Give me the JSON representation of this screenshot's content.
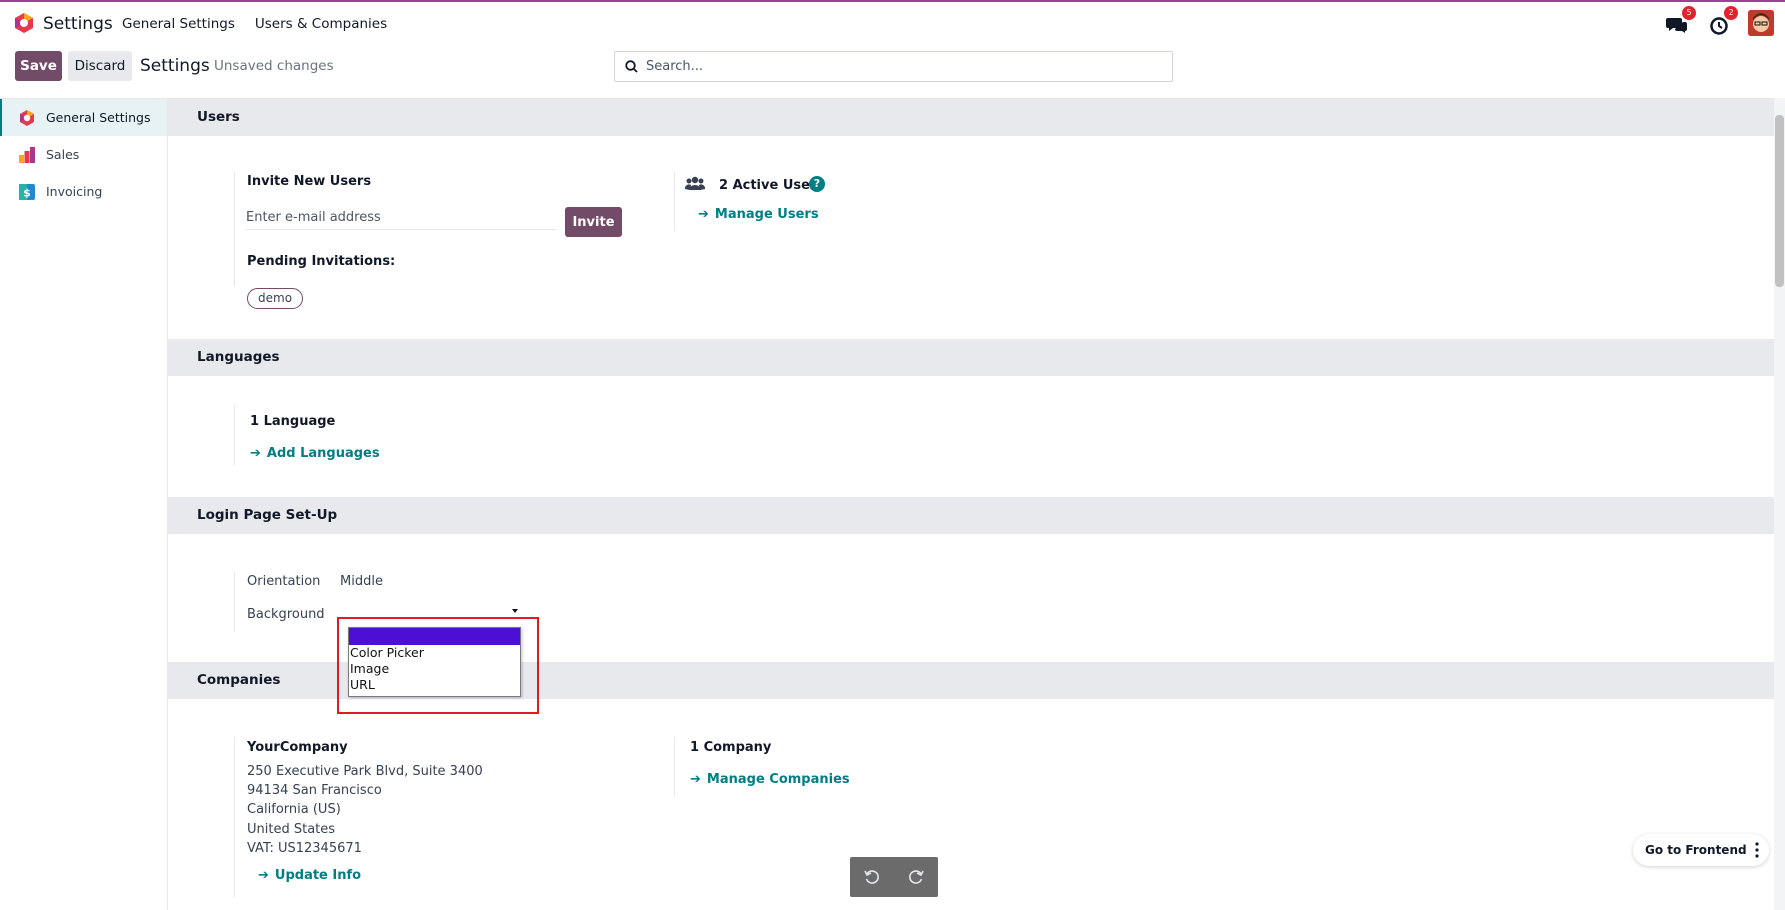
{
  "navbar": {
    "app_title": "Settings",
    "menu": [
      "General Settings",
      "Users & Companies"
    ],
    "messages_count": "5",
    "activities_count": "2"
  },
  "control_panel": {
    "save_label": "Save",
    "discard_label": "Discard",
    "title": "Settings",
    "status": "Unsaved changes",
    "search_placeholder": "Search..."
  },
  "sidebar": {
    "items": [
      {
        "label": "General Settings",
        "icon": "settings-app-icon",
        "active": true
      },
      {
        "label": "Sales",
        "icon": "sales-app-icon"
      },
      {
        "label": "Invoicing",
        "icon": "invoicing-app-icon"
      }
    ]
  },
  "users": {
    "header": "Users",
    "invite_title": "Invite New Users",
    "email_placeholder": "Enter e-mail address",
    "invite_label": "Invite",
    "pending_label": "Pending Invitations:",
    "pending_tags": [
      "demo"
    ],
    "active_users": "2 Active User",
    "help": "?",
    "manage_users": "Manage Users"
  },
  "languages": {
    "header": "Languages",
    "count": "1 Language",
    "add_languages": "Add Languages"
  },
  "login_page": {
    "header": "Login Page Set-Up",
    "orientation_label": "Orientation",
    "orientation_value": "Middle",
    "background_label": "Background",
    "background_options": [
      "",
      "Color Picker",
      "Image",
      "URL"
    ]
  },
  "companies": {
    "header": "Companies",
    "company_name": "YourCompany",
    "address_line1": "250 Executive Park Blvd, Suite 3400",
    "address_line2": "94134 San Francisco",
    "address_line3": "California (US)",
    "address_line4": "United States",
    "vat": "VAT: US12345671",
    "update_info": "Update Info",
    "count": "1 Company",
    "manage_companies": "Manage Companies"
  },
  "floating": {
    "go_to_frontend": "Go to Frontend"
  },
  "colors": {
    "primary": "#714b67",
    "link": "#017e84",
    "section_bg": "#e7e9ed",
    "highlight_box": "#e01b24",
    "selected_option": "#4b0fd6"
  }
}
